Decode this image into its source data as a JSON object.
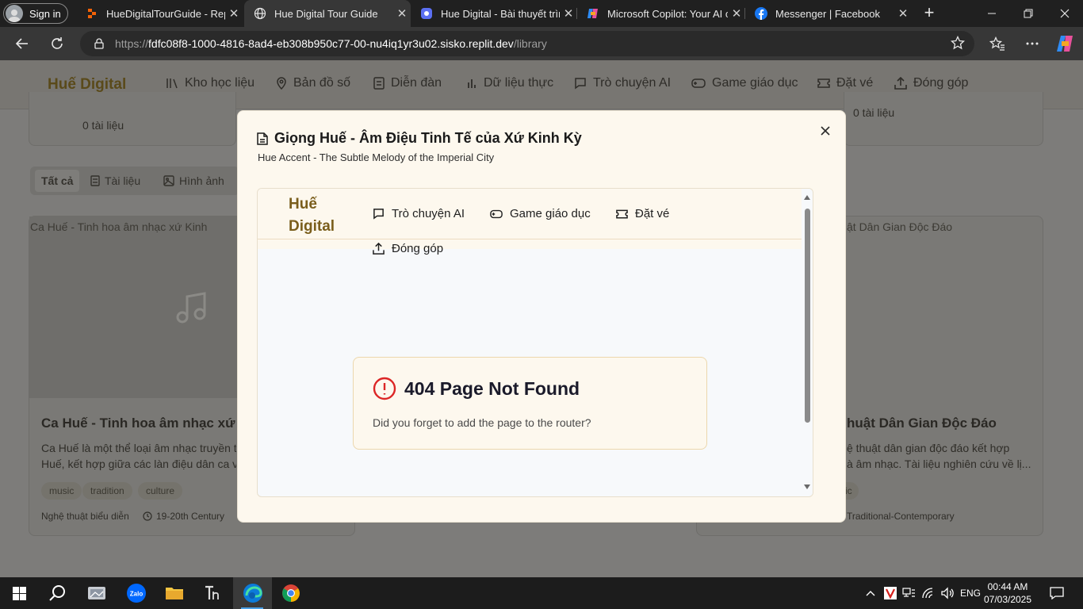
{
  "browser": {
    "signin_label": "Sign in",
    "tabs": [
      {
        "title": "HueDigitalTourGuide - Repli",
        "icon": "replit-icon"
      },
      {
        "title": "Hue Digital Tour Guide",
        "icon": "globe-icon",
        "active": true
      },
      {
        "title": "Hue Digital - Bài thuyết trình",
        "icon": "gamma-icon"
      },
      {
        "title": "Microsoft Copilot: Your AI co",
        "icon": "copilot-icon"
      },
      {
        "title": "Messenger | Facebook",
        "icon": "facebook-icon"
      }
    ],
    "url_prefix": "https://",
    "url_host": "fdfc08f8-1000-4816-8ad4-eb308b950c77-00-nu4iq1yr3u02.sisko.replit.dev",
    "url_path": "/library"
  },
  "background_page": {
    "logo": "Huế Digital",
    "nav": [
      "Kho học liệu",
      "Bản đồ số",
      "Diễn đàn",
      "Dữ liệu thực",
      "Trò chuyện AI",
      "Game giáo dục",
      "Đặt vé",
      "Đóng góp"
    ],
    "doc_count_left": "0 tài liệu",
    "doc_count_right": "0 tài liệu",
    "filters": [
      "Tất cả",
      "Tài liệu",
      "Hình ảnh"
    ],
    "card_left": {
      "image_alt": "Ca Huế - Tinh hoa âm nhạc xứ Kinh",
      "title": "Ca Huế - Tinh hoa âm nhạc xứ",
      "desc_line1": "Ca Huế là một thể loại âm nhạc truyền t",
      "desc_line2": "Huế, kết hợp giữa các làn điệu dân ca v",
      "tags": [
        "music",
        "tradition",
        "culture"
      ],
      "category": "Nghệ thuật biểu diễn",
      "period": "19-20th Century"
    },
    "card_right": {
      "image_alt": "ật Dân Gian Độc Đáo",
      "title": "huật Dân Gian Độc Đáo",
      "desc_line1": "ệ thuật dân gian độc đáo kết hợp",
      "desc_line2": "à âm nhạc. Tài liệu nghiên cứu về lị...",
      "tag": "ic",
      "period": "Traditional-Contemporary"
    }
  },
  "modal": {
    "title": "Giọng Huế - Âm Điệu Tinh Tế của Xứ Kinh Kỳ",
    "subtitle": "Hue Accent - The Subtle Melody of the Imperial City",
    "embedded": {
      "logo_line1": "Huế",
      "logo_line2": "Digital",
      "nav": [
        "Trò chuyện AI",
        "Game giáo dục",
        "Đặt vé",
        "Đóng góp"
      ],
      "error_title": "404 Page Not Found",
      "error_text": "Did you forget to add the page to the router?"
    }
  },
  "taskbar": {
    "lang": "ENG",
    "time": "00:44 AM",
    "date": "07/03/2025",
    "zalo_label": "Zalo"
  },
  "colors": {
    "modal_bg": "#fdf8ee",
    "brand_gold": "#7a5e1c",
    "error_red": "#dc2626"
  }
}
